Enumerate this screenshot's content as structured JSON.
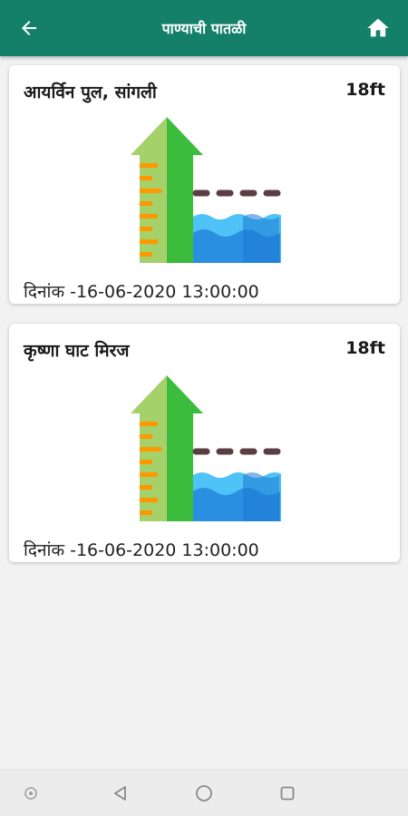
{
  "header": {
    "title": "पाण्याची पातळी",
    "back_icon": "arrow-left-icon",
    "home_icon": "home-icon",
    "background_color": "#15806a"
  },
  "cards": [
    {
      "name": "आयर्विन पुल, सांगली",
      "level": "18ft",
      "date": "दिनांक -16-06-2020 13:00:00",
      "icon": "water-level-icon"
    },
    {
      "name": "कृष्णा घाट मिरज",
      "level": "18ft",
      "date": "दिनांक -16-06-2020 13:00:00",
      "icon": "water-level-icon"
    }
  ],
  "system_nav": {
    "items": [
      "circle-dot-icon",
      "back-triangle-icon",
      "home-circle-icon",
      "recents-square-icon"
    ]
  }
}
